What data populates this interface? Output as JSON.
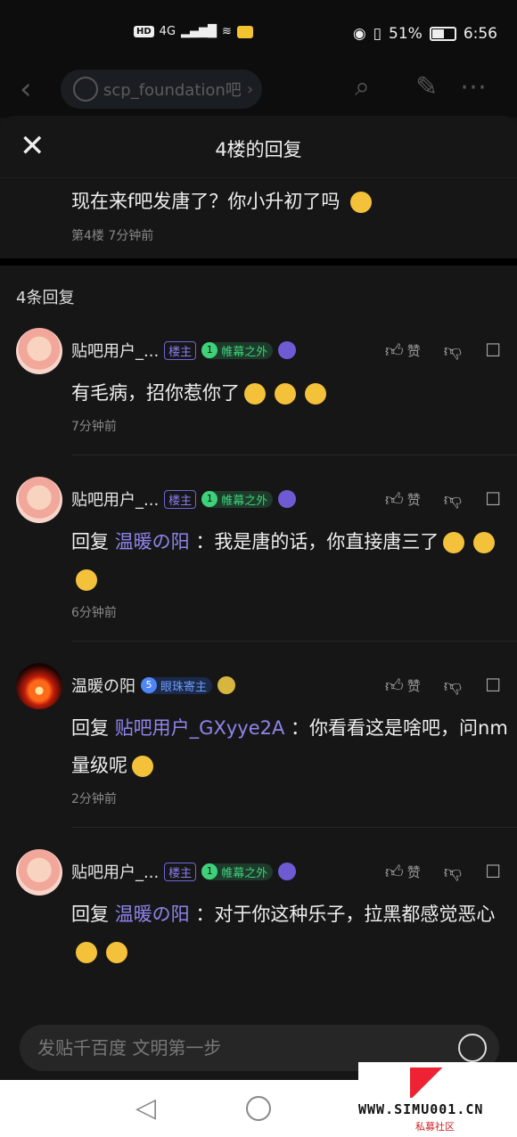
{
  "status_bar": {
    "hd": "HD",
    "network": "4G",
    "battery_pct": "51%",
    "time": "6:56"
  },
  "page_header": {
    "forum_name": "scp_foundation吧",
    "forum_chevron": "›"
  },
  "sheet": {
    "title": "4楼的回复",
    "original_post": {
      "text": "现在来f吧发唐了？你小升初了吗",
      "meta": "第4楼  7分钟前"
    },
    "reply_count": "4条回复"
  },
  "replies": [
    {
      "username": "贴吧用户_...",
      "op_badge": "楼主",
      "level": "1",
      "level_title": "帷幕之外",
      "prefix": "",
      "target": "",
      "text": "有毛病，招你惹你了",
      "time": "7分钟前",
      "like_label": "赞",
      "avatar": "pink",
      "emoji_count": 3
    },
    {
      "username": "贴吧用户_...",
      "op_badge": "楼主",
      "level": "1",
      "level_title": "帷幕之外",
      "prefix": "回复",
      "target": "温暖の阳",
      "text": "：我是唐的话，你直接唐三了",
      "time": "6分钟前",
      "like_label": "赞",
      "avatar": "pink",
      "emoji_count": 3
    },
    {
      "username": "温暖の阳",
      "op_badge": "",
      "level": "5",
      "level_title": "眼珠寄主",
      "prefix": "回复",
      "target": "贴吧用户_GXyye2A",
      "text": "：你看看这是啥吧，问nm量级呢",
      "time": "2分钟前",
      "like_label": "赞",
      "avatar": "sunset",
      "emoji_count": 1
    },
    {
      "username": "贴吧用户_...",
      "op_badge": "楼主",
      "level": "1",
      "level_title": "帷幕之外",
      "prefix": "回复",
      "target": "温暖の阳",
      "text": "：对于你这种乐子，拉黑都感觉恶心",
      "time": "",
      "like_label": "赞",
      "avatar": "pink",
      "emoji_count": 2
    }
  ],
  "input": {
    "placeholder": "发贴千百度 文明第一步"
  },
  "watermark": {
    "text": "WWW.SIMU001.CN",
    "sub": "私募社区"
  }
}
